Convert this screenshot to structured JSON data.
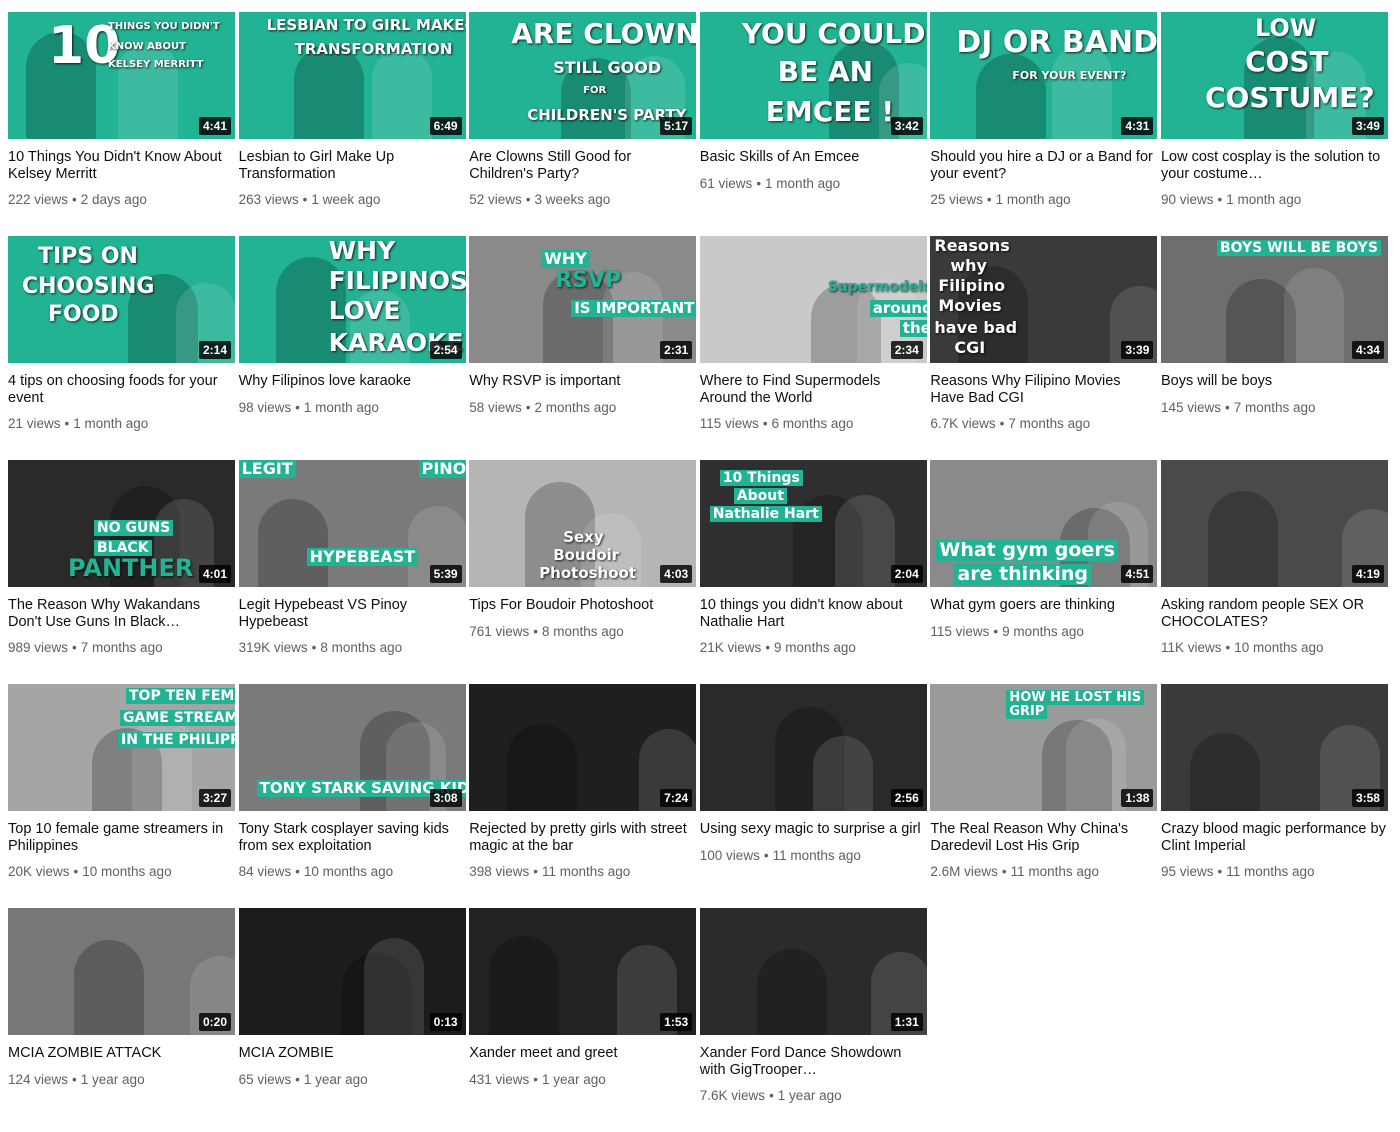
{
  "videos": [
    {
      "title": "10 Things You Didn't Know About Kelsey Merritt",
      "views": "222 views",
      "age": "2 days ago",
      "duration": "4:41",
      "bg": "#22b294",
      "thumb_text": [
        "10",
        "THINGS YOU DIDN'T",
        "KNOW ABOUT",
        "KELSEY MERRITT"
      ]
    },
    {
      "title": "Lesbian to Girl Make Up Transformation",
      "views": "263 views",
      "age": "1 week ago",
      "duration": "6:49",
      "bg": "#22b294",
      "thumb_text": [
        "LESBIAN TO GIRL MAKE-UP",
        "TRANSFORMATION"
      ]
    },
    {
      "title": "Are Clowns Still Good for Children's Party?",
      "views": "52 views",
      "age": "3 weeks ago",
      "duration": "5:17",
      "bg": "#22b294",
      "thumb_text": [
        "ARE CLOWNS",
        "STILL GOOD",
        "FOR",
        "CHILDREN'S PARTY"
      ]
    },
    {
      "title": "Basic Skills of An Emcee",
      "views": "61 views",
      "age": "1 month ago",
      "duration": "3:42",
      "bg": "#22b294",
      "thumb_text": [
        "YOU COULD",
        "BE AN",
        "EMCEE !"
      ]
    },
    {
      "title": "Should you hire a DJ or a Band for your event?",
      "views": "25 views",
      "age": "1 month ago",
      "duration": "4:31",
      "bg": "#22b294",
      "thumb_text": [
        "DJ OR BANDS",
        "FOR YOUR EVENT?"
      ]
    },
    {
      "title": "Low cost cosplay is the solution to your costume…",
      "views": "90 views",
      "age": "1 month ago",
      "duration": "3:49",
      "bg": "#22b294",
      "thumb_text": [
        "LOW",
        "COST",
        "COSTUME?"
      ]
    },
    {
      "title": "4 tips on choosing foods for your event",
      "views": "21 views",
      "age": "1 month ago",
      "duration": "2:14",
      "bg": "#22b294",
      "thumb_text": [
        "TIPS ON",
        "CHOOSING",
        "FOOD"
      ]
    },
    {
      "title": "Why Filipinos love karaoke",
      "views": "98 views",
      "age": "1 month ago",
      "duration": "2:54",
      "bg": "#22b294",
      "thumb_text": [
        "WHY",
        "FILIPINOS",
        "LOVE",
        "KARAOKE"
      ]
    },
    {
      "title": "Why RSVP is important",
      "views": "58 views",
      "age": "2 months ago",
      "duration": "2:31",
      "bg": "#8a8a8a",
      "thumb_text": [
        "WHY",
        "RSVP",
        "IS IMPORTANT"
      ]
    },
    {
      "title": "Where to Find Supermodels Around the World",
      "views": "115 views",
      "age": "6 months ago",
      "duration": "2:34",
      "bg": "#c9c9c9",
      "thumb_text": [
        "Supermodels",
        "around",
        "the"
      ]
    },
    {
      "title": "Reasons Why Filipino Movies Have Bad CGI",
      "views": "6.7K views",
      "age": "7 months ago",
      "duration": "3:39",
      "bg": "#3a3a3a",
      "thumb_text": [
        "Reasons",
        "why",
        "Filipino",
        "Movies",
        "have bad",
        "CGI"
      ]
    },
    {
      "title": "Boys will be boys",
      "views": "145 views",
      "age": "7 months ago",
      "duration": "4:34",
      "bg": "#6e6e6e",
      "thumb_text": [
        "BOYS WILL BE BOYS"
      ]
    },
    {
      "title": "The Reason Why Wakandans Don't Use Guns In Black…",
      "views": "989 views",
      "age": "7 months ago",
      "duration": "4:01",
      "bg": "#2a2a2a",
      "thumb_text": [
        "NO GUNS",
        "BLACK",
        "PANTHER"
      ]
    },
    {
      "title": "Legit Hypebeast VS Pinoy Hypebeast",
      "views": "319K views",
      "age": "8 months ago",
      "duration": "5:39",
      "bg": "#7a7a7a",
      "thumb_text": [
        "LEGIT",
        "PINOY",
        "HYPEBEAST"
      ]
    },
    {
      "title": "Tips For Boudoir Photoshoot",
      "views": "761 views",
      "age": "8 months ago",
      "duration": "4:03",
      "bg": "#b5b5b5",
      "thumb_text": [
        "Sexy",
        "Boudoir",
        "Photoshoot"
      ]
    },
    {
      "title": "10 things you didn't know about Nathalie Hart",
      "views": "21K views",
      "age": "9 months ago",
      "duration": "2:04",
      "bg": "#2f2f2f",
      "thumb_text": [
        "10 Things",
        "About",
        "Nathalie Hart"
      ]
    },
    {
      "title": "What gym goers are thinking",
      "views": "115 views",
      "age": "9 months ago",
      "duration": "4:51",
      "bg": "#8a8a8a",
      "thumb_text": [
        "What gym goers",
        "are thinking"
      ]
    },
    {
      "title": "Asking random people SEX OR CHOCOLATES?",
      "views": "11K views",
      "age": "10 months ago",
      "duration": "4:19",
      "bg": "#4a4a4a",
      "thumb_text": []
    },
    {
      "title": "Top 10 female game streamers in Philippines",
      "views": "20K views",
      "age": "10 months ago",
      "duration": "3:27",
      "bg": "#a5a5a5",
      "thumb_text": [
        "TOP TEN FEMALE",
        "GAME STREAMERS",
        "IN THE PHILIPPINES"
      ]
    },
    {
      "title": "Tony Stark cosplayer saving kids from sex exploitation",
      "views": "84 views",
      "age": "10 months ago",
      "duration": "3:08",
      "bg": "#7a7a7a",
      "thumb_text": [
        "TONY STARK SAVING KIDS"
      ]
    },
    {
      "title": "Rejected by pretty girls with street magic at the bar",
      "views": "398 views",
      "age": "11 months ago",
      "duration": "7:24",
      "bg": "#1f1f1f",
      "thumb_text": []
    },
    {
      "title": "Using sexy magic to surprise a girl",
      "views": "100 views",
      "age": "11 months ago",
      "duration": "2:56",
      "bg": "#2a2a2a",
      "thumb_text": []
    },
    {
      "title": "The Real Reason Why China's Daredevil Lost His Grip",
      "views": "2.6M views",
      "age": "11 months ago",
      "duration": "1:38",
      "bg": "#9a9a9a",
      "thumb_text": [
        "HOW HE LOST HIS",
        "GRIP"
      ]
    },
    {
      "title": "Crazy blood magic performance by Clint Imperial",
      "views": "95 views",
      "age": "11 months ago",
      "duration": "3:58",
      "bg": "#3a3a3a",
      "thumb_text": []
    },
    {
      "title": "MCIA ZOMBIE ATTACK",
      "views": "124 views",
      "age": "1 year ago",
      "duration": "0:20",
      "bg": "#777777",
      "thumb_text": []
    },
    {
      "title": "MCIA ZOMBIE",
      "views": "65 views",
      "age": "1 year ago",
      "duration": "0:13",
      "bg": "#1c1c1c",
      "thumb_text": []
    },
    {
      "title": "Xander meet and greet",
      "views": "431 views",
      "age": "1 year ago",
      "duration": "1:53",
      "bg": "#222222",
      "thumb_text": []
    },
    {
      "title": "Xander Ford Dance Showdown with GigTrooper…",
      "views": "7.6K views",
      "age": "1 year ago",
      "duration": "1:31",
      "bg": "#2b2b2b",
      "thumb_text": []
    }
  ]
}
